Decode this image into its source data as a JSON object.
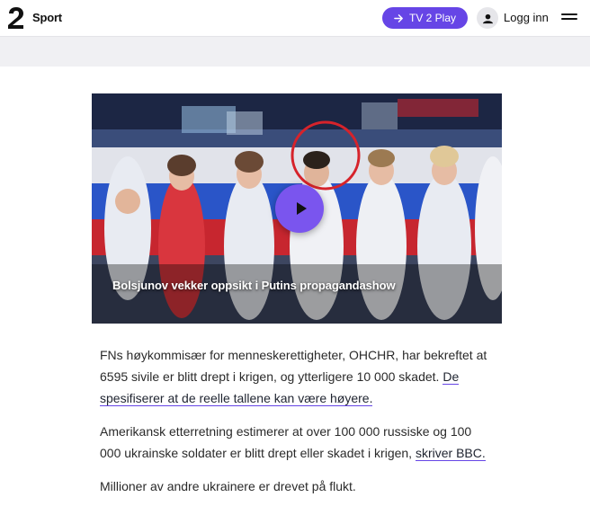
{
  "header": {
    "logo_label": "TV 2",
    "section": "Sport",
    "play_button": "TV 2 Play",
    "login": "Logg inn",
    "icons": [
      "tv2-logo-icon",
      "arrow-right-icon",
      "user-icon",
      "hamburger-menu-icon"
    ],
    "accent_color": "#6645e6"
  },
  "video": {
    "title": "Bolsjunov vekker oppsikt i Putins propagandashow",
    "play_icon": "play-icon"
  },
  "article": {
    "p1_text": "FNs høykommisær for menneskerettigheter, OHCHR, har bekreftet at 6595 sivile er blitt drept i krigen, og ytterligere 10 000 skadet. ",
    "p1_link": "De spesifiserer at de reelle tallene kan være høyere.",
    "p2_text": "Amerikansk etterretning estimerer at over 100 000 russiske og 100 000 ukrainske soldater er blitt drept eller skadet i krigen, ",
    "p2_link": "skriver BBC.",
    "p3_text": "Millioner av andre ukrainere er drevet på flukt."
  }
}
